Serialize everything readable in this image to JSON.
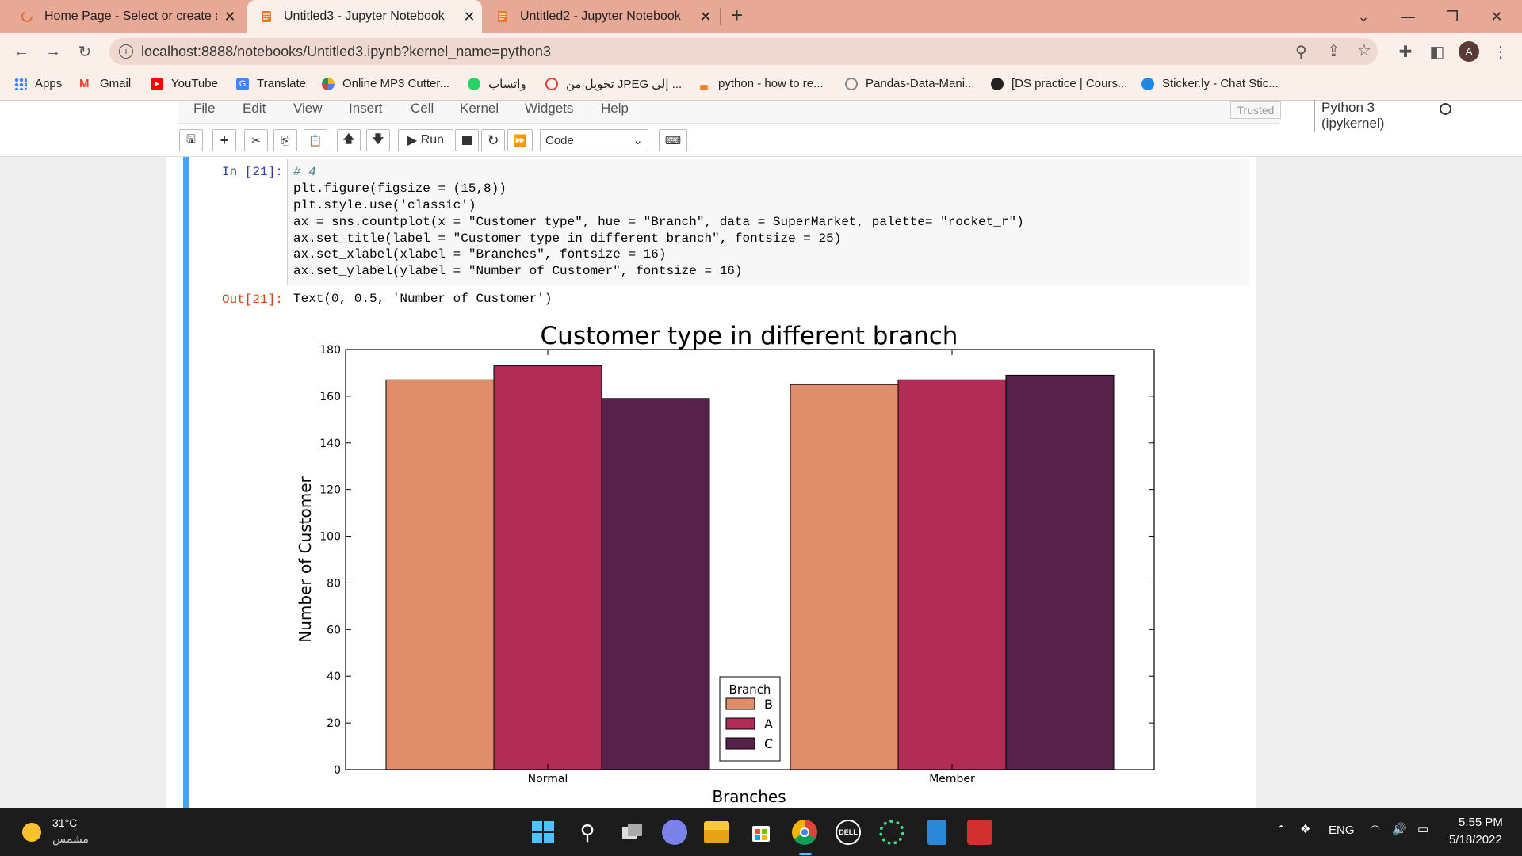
{
  "browser": {
    "tabs": [
      {
        "title": "Home Page - Select or create a n",
        "active": false
      },
      {
        "title": "Untitled3 - Jupyter Notebook",
        "active": true
      },
      {
        "title": "Untitled2 - Jupyter Notebook",
        "active": false
      }
    ],
    "new_tab": "+",
    "url": "localhost:8888/notebooks/Untitled3.ipynb?kernel_name=python3",
    "profile_initial": "A",
    "bookmarks": [
      {
        "label": "Apps"
      },
      {
        "label": "Gmail"
      },
      {
        "label": "YouTube"
      },
      {
        "label": "Translate"
      },
      {
        "label": "Online MP3 Cutter..."
      },
      {
        "label": "واتساب"
      },
      {
        "label": "تحويل من JPEG إلى ..."
      },
      {
        "label": "python - how to re..."
      },
      {
        "label": "Pandas-Data-Mani..."
      },
      {
        "label": "[DS practice | Cours..."
      },
      {
        "label": "Sticker.ly - Chat Stic..."
      }
    ]
  },
  "jupyter": {
    "menu": [
      "File",
      "Edit",
      "View",
      "Insert",
      "Cell",
      "Kernel",
      "Widgets",
      "Help"
    ],
    "trusted": "Trusted",
    "kernel": "Python 3 (ipykernel)",
    "run_label": "Run",
    "cell_type": "Code"
  },
  "cell": {
    "in_prompt": "In [21]:",
    "out_prompt": "Out[21]:",
    "code": [
      "# 4",
      "plt.figure(figsize = (15,8))",
      "plt.style.use('classic')",
      "ax = sns.countplot(x = \"Customer type\", hue = \"Branch\", data = SuperMarket, palette= \"rocket_r\")",
      "ax.set_title(label = \"Customer type in different branch\", fontsize = 25)",
      "ax.set_xlabel(xlabel = \"Branches\", fontsize = 16)",
      "ax.set_ylabel(ylabel = \"Number of Customer\", fontsize = 16)"
    ],
    "output_text": "Text(0, 0.5, 'Number of Customer')"
  },
  "chart_data": {
    "type": "bar",
    "title": "Customer type in different branch",
    "xlabel": "Branches",
    "ylabel": "Number of Customer",
    "categories": [
      "Normal",
      "Member"
    ],
    "series": [
      {
        "name": "B",
        "values": [
          167,
          165
        ],
        "color": "#e08d6c"
      },
      {
        "name": "A",
        "values": [
          173,
          167
        ],
        "color": "#b22d55"
      },
      {
        "name": "C",
        "values": [
          159,
          169
        ],
        "color": "#56224a"
      }
    ],
    "ylim": [
      0,
      180
    ],
    "yticks": [
      0,
      20,
      40,
      60,
      80,
      100,
      120,
      140,
      160,
      180
    ],
    "legend_title": "Branch",
    "legend_position": "lower center",
    "grid": false
  },
  "taskbar": {
    "weather_temp": "31°C",
    "weather_desc": "مشمس",
    "lang": "ENG",
    "time": "5:55 PM",
    "date": "5/18/2022"
  }
}
